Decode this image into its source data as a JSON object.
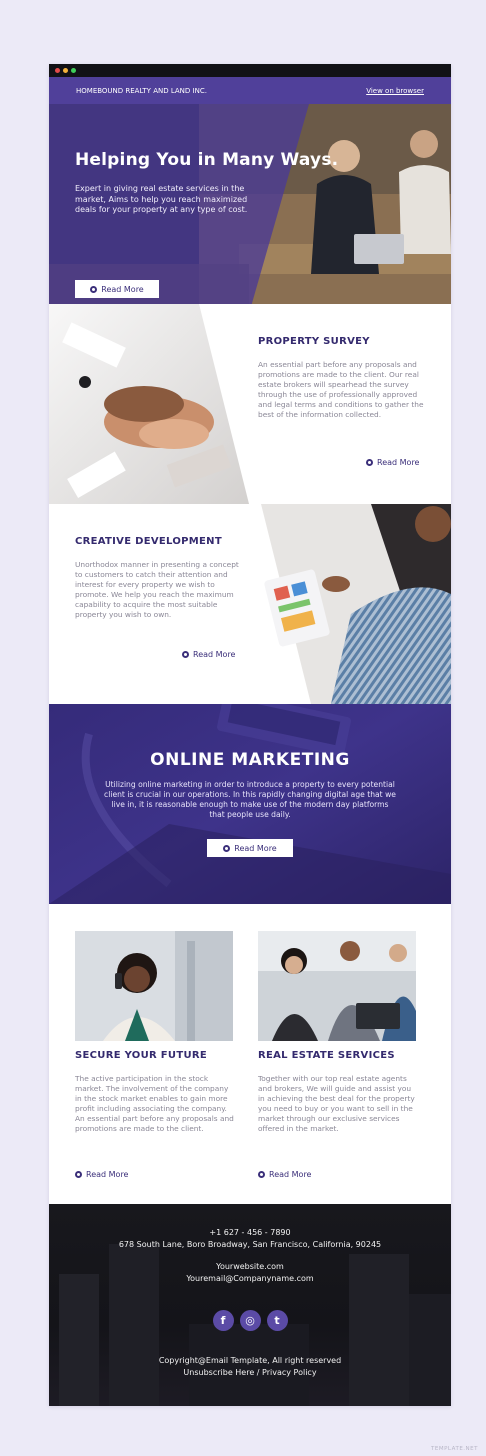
{
  "colors": {
    "accent": "#50409a",
    "dark": "#342a6e",
    "footer": "#141419"
  },
  "window": {
    "dots": [
      "#e24b4b",
      "#f3b23b",
      "#3fcf5a"
    ]
  },
  "header": {
    "company": "HOMEBOUND REALTY AND LAND INC.",
    "view_link": "View on browser"
  },
  "hero": {
    "title": "Helping You in Many Ways.",
    "text": "Expert in giving real estate services in the market, Aims to help you reach maximized deals for your property at any type of cost.",
    "button": "Read More"
  },
  "property_survey": {
    "title": "PROPERTY SURVEY",
    "text": "An essential part before any proposals and promotions are made to the client. Our real estate brokers will spearhead the survey through the use of professionally approved and legal terms and conditions to gather the best of the information collected.",
    "link": "Read More"
  },
  "creative_development": {
    "title": "CREATIVE DEVELOPMENT",
    "text": "Unorthodox manner in presenting a concept to customers to catch their attention and interest for every property we wish to promote. We help you reach the maximum capability to acquire the most suitable property you wish to own.",
    "link": "Read More"
  },
  "online_marketing": {
    "title": "ONLINE MARKETING",
    "text": "Utilizing online marketing in order to introduce a property to every potential client is crucial in our operations. In this rapidly changing digital age that we live in, it is reasonable enough to make use of the modern day platforms that people use daily.",
    "button": "Read More"
  },
  "secure_future": {
    "title": "SECURE YOUR FUTURE",
    "text": "The active participation in the stock market. The involvement of the company in the stock market enables to gain more profit including associating the company. An essential part before any proposals and promotions are made to the client.",
    "link": "Read More"
  },
  "real_estate_services": {
    "title": "REAL ESTATE SERVICES",
    "text": "Together with our top real estate agents and brokers, We will guide and assist you in achieving the best deal for the property you need to buy or you want to sell in the market through our exclusive services offered in the market.",
    "link": "Read More"
  },
  "footer": {
    "phone": "+1 627 - 456 - 7890",
    "address": "678 South Lane, Boro Broadway, San Francisco, California, 90245",
    "website": "Yourwebsite.com",
    "email": "Youremail@Companyname.com",
    "social": {
      "facebook": "f",
      "instagram": "◎",
      "twitter": "t"
    },
    "copyright": "Copyright@Email Template, All right reserved",
    "unsubscribe": "Unsubscribe Here / Privacy Policy"
  },
  "watermark": "TEMPLATE.NET"
}
